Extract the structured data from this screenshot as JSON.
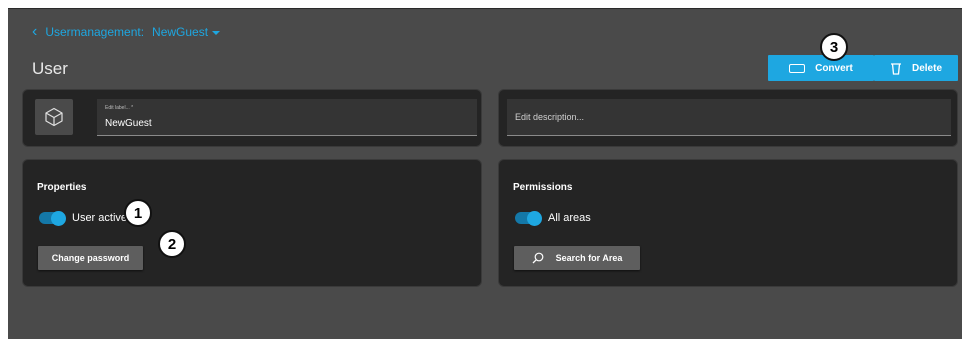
{
  "breadcrumb": {
    "parent": "Usermanagement:",
    "current": "NewGuest"
  },
  "page_title": "User",
  "toolbar": {
    "convert_label": "Convert",
    "delete_label": "Delete"
  },
  "label_field": {
    "caption": "Edit label... *",
    "value": "NewGuest"
  },
  "description_field": {
    "placeholder": "Edit description..."
  },
  "properties": {
    "title": "Properties",
    "user_active_label": "User active",
    "user_active": true,
    "change_password_label": "Change password"
  },
  "permissions": {
    "title": "Permissions",
    "all_areas_label": "All areas",
    "all_areas": true,
    "search_area_label": "Search for Area"
  },
  "callouts": [
    "1",
    "2",
    "3"
  ],
  "colors": {
    "accent": "#1ea7e1",
    "background": "#4a4a4a",
    "card": "#242424"
  }
}
